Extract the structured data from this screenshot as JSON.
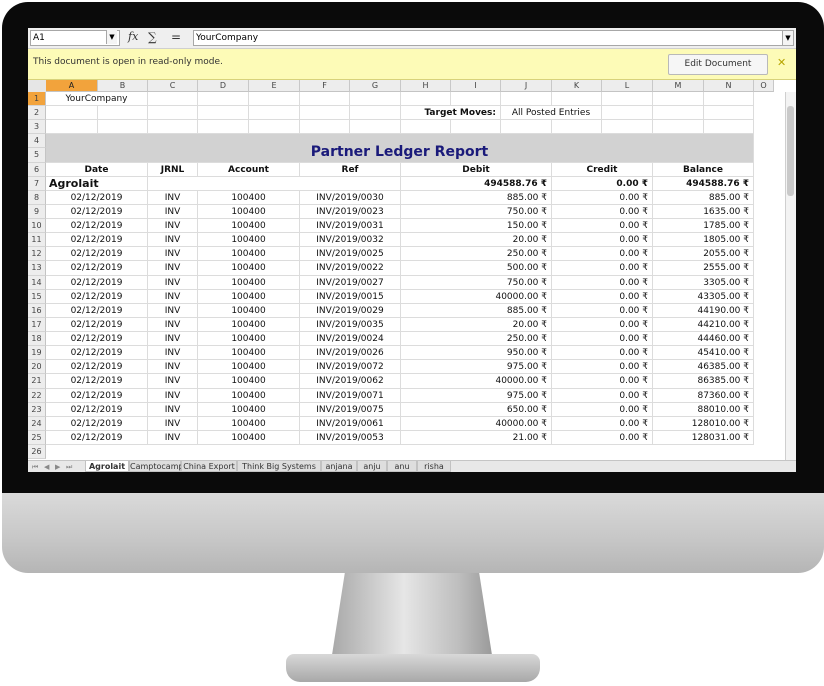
{
  "formula_bar": {
    "cell_ref": "A1",
    "fx_symbol": "fx",
    "sigma_symbol": "∑",
    "equals_symbol": "=",
    "input_value": "YourCompany"
  },
  "infobar": {
    "message": "This document is open in read-only mode.",
    "edit_button": "Edit Document",
    "close_symbol": "✕"
  },
  "columns": [
    "A",
    "B",
    "C",
    "D",
    "E",
    "F",
    "G",
    "H",
    "I",
    "J",
    "K",
    "L",
    "M",
    "N",
    "O"
  ],
  "rows_visible": [
    "1",
    "2",
    "3",
    "4",
    "5",
    "6",
    "7",
    "8",
    "9",
    "10",
    "11",
    "12",
    "13",
    "14",
    "15",
    "16",
    "17",
    "18",
    "19",
    "20",
    "21",
    "22",
    "23",
    "24",
    "25",
    "26"
  ],
  "report": {
    "company": "YourCompany",
    "target_moves_label": "Target Moves:",
    "target_moves_value": "All Posted Entries",
    "title": "Partner Ledger Report",
    "headers": {
      "date": "Date",
      "jrnl": "JRNL",
      "account": "Account",
      "ref": "Ref",
      "debit": "Debit",
      "credit": "Credit",
      "balance": "Balance"
    },
    "partner": {
      "name": "Agrolait",
      "debit": "494588.76 ₹",
      "credit": "0.00 ₹",
      "balance": "494588.76 ₹"
    },
    "lines": [
      {
        "date": "02/12/2019",
        "jrnl": "INV",
        "account": "100400",
        "ref": "INV/2019/0030",
        "debit": "885.00 ₹",
        "credit": "0.00 ₹",
        "balance": "885.00 ₹"
      },
      {
        "date": "02/12/2019",
        "jrnl": "INV",
        "account": "100400",
        "ref": "INV/2019/0023",
        "debit": "750.00 ₹",
        "credit": "0.00 ₹",
        "balance": "1635.00 ₹"
      },
      {
        "date": "02/12/2019",
        "jrnl": "INV",
        "account": "100400",
        "ref": "INV/2019/0031",
        "debit": "150.00 ₹",
        "credit": "0.00 ₹",
        "balance": "1785.00 ₹"
      },
      {
        "date": "02/12/2019",
        "jrnl": "INV",
        "account": "100400",
        "ref": "INV/2019/0032",
        "debit": "20.00 ₹",
        "credit": "0.00 ₹",
        "balance": "1805.00 ₹"
      },
      {
        "date": "02/12/2019",
        "jrnl": "INV",
        "account": "100400",
        "ref": "INV/2019/0025",
        "debit": "250.00 ₹",
        "credit": "0.00 ₹",
        "balance": "2055.00 ₹"
      },
      {
        "date": "02/12/2019",
        "jrnl": "INV",
        "account": "100400",
        "ref": "INV/2019/0022",
        "debit": "500.00 ₹",
        "credit": "0.00 ₹",
        "balance": "2555.00 ₹"
      },
      {
        "date": "02/12/2019",
        "jrnl": "INV",
        "account": "100400",
        "ref": "INV/2019/0027",
        "debit": "750.00 ₹",
        "credit": "0.00 ₹",
        "balance": "3305.00 ₹"
      },
      {
        "date": "02/12/2019",
        "jrnl": "INV",
        "account": "100400",
        "ref": "INV/2019/0015",
        "debit": "40000.00 ₹",
        "credit": "0.00 ₹",
        "balance": "43305.00 ₹"
      },
      {
        "date": "02/12/2019",
        "jrnl": "INV",
        "account": "100400",
        "ref": "INV/2019/0029",
        "debit": "885.00 ₹",
        "credit": "0.00 ₹",
        "balance": "44190.00 ₹"
      },
      {
        "date": "02/12/2019",
        "jrnl": "INV",
        "account": "100400",
        "ref": "INV/2019/0035",
        "debit": "20.00 ₹",
        "credit": "0.00 ₹",
        "balance": "44210.00 ₹"
      },
      {
        "date": "02/12/2019",
        "jrnl": "INV",
        "account": "100400",
        "ref": "INV/2019/0024",
        "debit": "250.00 ₹",
        "credit": "0.00 ₹",
        "balance": "44460.00 ₹"
      },
      {
        "date": "02/12/2019",
        "jrnl": "INV",
        "account": "100400",
        "ref": "INV/2019/0026",
        "debit": "950.00 ₹",
        "credit": "0.00 ₹",
        "balance": "45410.00 ₹"
      },
      {
        "date": "02/12/2019",
        "jrnl": "INV",
        "account": "100400",
        "ref": "INV/2019/0072",
        "debit": "975.00 ₹",
        "credit": "0.00 ₹",
        "balance": "46385.00 ₹"
      },
      {
        "date": "02/12/2019",
        "jrnl": "INV",
        "account": "100400",
        "ref": "INV/2019/0062",
        "debit": "40000.00 ₹",
        "credit": "0.00 ₹",
        "balance": "86385.00 ₹"
      },
      {
        "date": "02/12/2019",
        "jrnl": "INV",
        "account": "100400",
        "ref": "INV/2019/0071",
        "debit": "975.00 ₹",
        "credit": "0.00 ₹",
        "balance": "87360.00 ₹"
      },
      {
        "date": "02/12/2019",
        "jrnl": "INV",
        "account": "100400",
        "ref": "INV/2019/0075",
        "debit": "650.00 ₹",
        "credit": "0.00 ₹",
        "balance": "88010.00 ₹"
      },
      {
        "date": "02/12/2019",
        "jrnl": "INV",
        "account": "100400",
        "ref": "INV/2019/0061",
        "debit": "40000.00 ₹",
        "credit": "0.00 ₹",
        "balance": "128010.00 ₹"
      },
      {
        "date": "02/12/2019",
        "jrnl": "INV",
        "account": "100400",
        "ref": "INV/2019/0053",
        "debit": "21.00 ₹",
        "credit": "0.00 ₹",
        "balance": "128031.00 ₹"
      }
    ]
  },
  "sheet_tabs": [
    "Agrolait",
    "Camptocamp",
    "China Export",
    "Think Big Systems",
    "anjana",
    "anju",
    "anu",
    "risha"
  ],
  "active_tab": "Agrolait",
  "colors": {
    "selection": "#f2a33c",
    "title": "#1a1a7a",
    "infobar": "#fdfbb7",
    "bezel": "#0a0a0a"
  }
}
